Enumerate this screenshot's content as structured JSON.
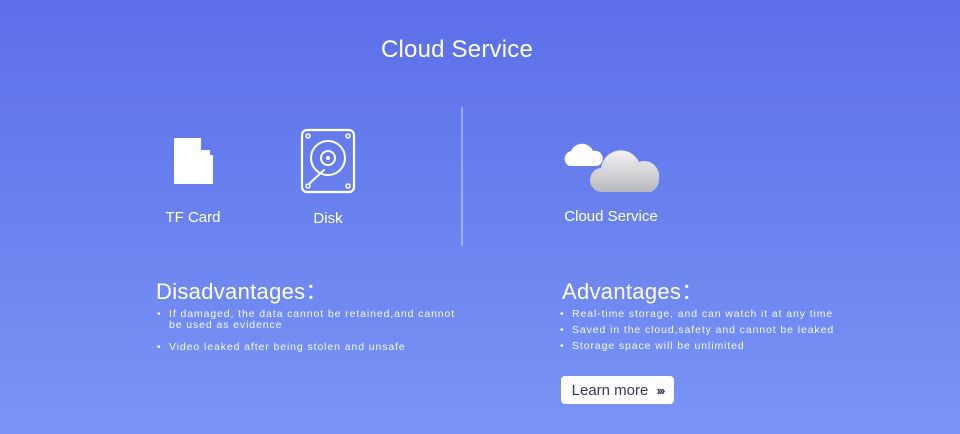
{
  "header": {
    "title": "Cloud Service"
  },
  "features": {
    "tf_card": {
      "label": "TF Card",
      "icon": "sd-card-icon"
    },
    "disk": {
      "label": "Disk",
      "icon": "hard-disk-icon"
    },
    "cloud": {
      "label": "Cloud Service",
      "icon": "cloud-icon"
    }
  },
  "disadvantages": {
    "heading": "Disadvantages：",
    "items": [
      "If damaged, the data cannot be retained,and cannot be used as evidence",
      "Video leaked after being stolen and unsafe"
    ]
  },
  "advantages": {
    "heading": "Advantages：",
    "items": [
      "Real-time storage, and can watch it at any time",
      "Saved in the cloud,safety and cannot be leaked",
      "Storage space will be unlimited"
    ]
  },
  "cta": {
    "label": "Learn more",
    "chevron": "›››",
    "icon": "triple-chevron-right-icon"
  },
  "colors": {
    "bg_top": "#5d6ee9",
    "bg_bottom": "#7b95f6",
    "text": "#ffffff",
    "button_text": "#333a5a"
  }
}
